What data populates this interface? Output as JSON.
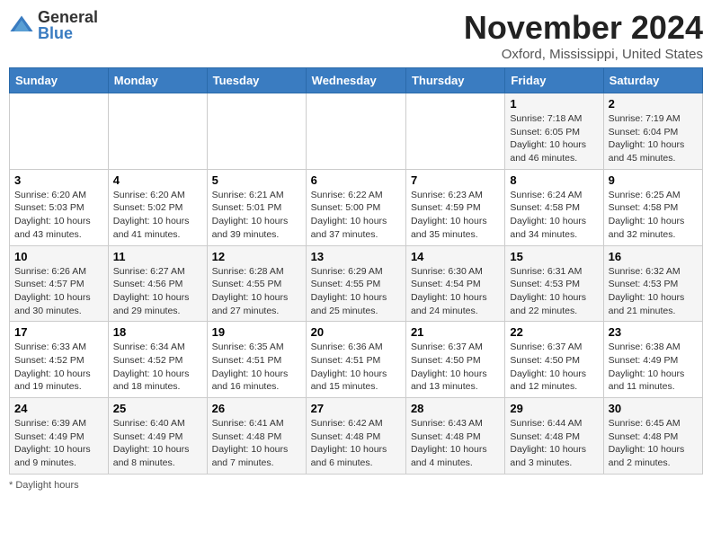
{
  "logo": {
    "general": "General",
    "blue": "Blue"
  },
  "title": {
    "month_year": "November 2024",
    "location": "Oxford, Mississippi, United States"
  },
  "weekdays": [
    "Sunday",
    "Monday",
    "Tuesday",
    "Wednesday",
    "Thursday",
    "Friday",
    "Saturday"
  ],
  "footer": {
    "daylight_label": "Daylight hours"
  },
  "weeks": [
    [
      {
        "day": "",
        "info": ""
      },
      {
        "day": "",
        "info": ""
      },
      {
        "day": "",
        "info": ""
      },
      {
        "day": "",
        "info": ""
      },
      {
        "day": "",
        "info": ""
      },
      {
        "day": "1",
        "info": "Sunrise: 7:18 AM\nSunset: 6:05 PM\nDaylight: 10 hours and 46 minutes."
      },
      {
        "day": "2",
        "info": "Sunrise: 7:19 AM\nSunset: 6:04 PM\nDaylight: 10 hours and 45 minutes."
      }
    ],
    [
      {
        "day": "3",
        "info": "Sunrise: 6:20 AM\nSunset: 5:03 PM\nDaylight: 10 hours and 43 minutes."
      },
      {
        "day": "4",
        "info": "Sunrise: 6:20 AM\nSunset: 5:02 PM\nDaylight: 10 hours and 41 minutes."
      },
      {
        "day": "5",
        "info": "Sunrise: 6:21 AM\nSunset: 5:01 PM\nDaylight: 10 hours and 39 minutes."
      },
      {
        "day": "6",
        "info": "Sunrise: 6:22 AM\nSunset: 5:00 PM\nDaylight: 10 hours and 37 minutes."
      },
      {
        "day": "7",
        "info": "Sunrise: 6:23 AM\nSunset: 4:59 PM\nDaylight: 10 hours and 35 minutes."
      },
      {
        "day": "8",
        "info": "Sunrise: 6:24 AM\nSunset: 4:58 PM\nDaylight: 10 hours and 34 minutes."
      },
      {
        "day": "9",
        "info": "Sunrise: 6:25 AM\nSunset: 4:58 PM\nDaylight: 10 hours and 32 minutes."
      }
    ],
    [
      {
        "day": "10",
        "info": "Sunrise: 6:26 AM\nSunset: 4:57 PM\nDaylight: 10 hours and 30 minutes."
      },
      {
        "day": "11",
        "info": "Sunrise: 6:27 AM\nSunset: 4:56 PM\nDaylight: 10 hours and 29 minutes."
      },
      {
        "day": "12",
        "info": "Sunrise: 6:28 AM\nSunset: 4:55 PM\nDaylight: 10 hours and 27 minutes."
      },
      {
        "day": "13",
        "info": "Sunrise: 6:29 AM\nSunset: 4:55 PM\nDaylight: 10 hours and 25 minutes."
      },
      {
        "day": "14",
        "info": "Sunrise: 6:30 AM\nSunset: 4:54 PM\nDaylight: 10 hours and 24 minutes."
      },
      {
        "day": "15",
        "info": "Sunrise: 6:31 AM\nSunset: 4:53 PM\nDaylight: 10 hours and 22 minutes."
      },
      {
        "day": "16",
        "info": "Sunrise: 6:32 AM\nSunset: 4:53 PM\nDaylight: 10 hours and 21 minutes."
      }
    ],
    [
      {
        "day": "17",
        "info": "Sunrise: 6:33 AM\nSunset: 4:52 PM\nDaylight: 10 hours and 19 minutes."
      },
      {
        "day": "18",
        "info": "Sunrise: 6:34 AM\nSunset: 4:52 PM\nDaylight: 10 hours and 18 minutes."
      },
      {
        "day": "19",
        "info": "Sunrise: 6:35 AM\nSunset: 4:51 PM\nDaylight: 10 hours and 16 minutes."
      },
      {
        "day": "20",
        "info": "Sunrise: 6:36 AM\nSunset: 4:51 PM\nDaylight: 10 hours and 15 minutes."
      },
      {
        "day": "21",
        "info": "Sunrise: 6:37 AM\nSunset: 4:50 PM\nDaylight: 10 hours and 13 minutes."
      },
      {
        "day": "22",
        "info": "Sunrise: 6:37 AM\nSunset: 4:50 PM\nDaylight: 10 hours and 12 minutes."
      },
      {
        "day": "23",
        "info": "Sunrise: 6:38 AM\nSunset: 4:49 PM\nDaylight: 10 hours and 11 minutes."
      }
    ],
    [
      {
        "day": "24",
        "info": "Sunrise: 6:39 AM\nSunset: 4:49 PM\nDaylight: 10 hours and 9 minutes."
      },
      {
        "day": "25",
        "info": "Sunrise: 6:40 AM\nSunset: 4:49 PM\nDaylight: 10 hours and 8 minutes."
      },
      {
        "day": "26",
        "info": "Sunrise: 6:41 AM\nSunset: 4:48 PM\nDaylight: 10 hours and 7 minutes."
      },
      {
        "day": "27",
        "info": "Sunrise: 6:42 AM\nSunset: 4:48 PM\nDaylight: 10 hours and 6 minutes."
      },
      {
        "day": "28",
        "info": "Sunrise: 6:43 AM\nSunset: 4:48 PM\nDaylight: 10 hours and 4 minutes."
      },
      {
        "day": "29",
        "info": "Sunrise: 6:44 AM\nSunset: 4:48 PM\nDaylight: 10 hours and 3 minutes."
      },
      {
        "day": "30",
        "info": "Sunrise: 6:45 AM\nSunset: 4:48 PM\nDaylight: 10 hours and 2 minutes."
      }
    ]
  ]
}
